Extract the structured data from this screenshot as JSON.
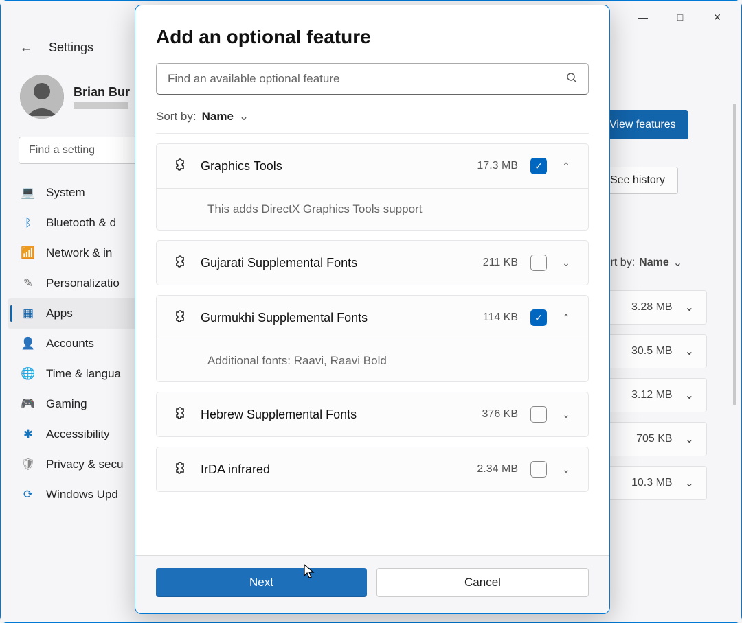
{
  "window": {
    "titlebar": {
      "minimize": "—",
      "maximize": "□",
      "close": "✕"
    },
    "back_label": "←",
    "app_title": "Settings",
    "user_name": "Brian Bur",
    "find_setting_placeholder": "Find a setting",
    "sidebar": [
      {
        "icon": "💻",
        "label": "System",
        "color": "#0078d4"
      },
      {
        "icon": "ᛒ",
        "label": "Bluetooth & d",
        "color": "#0078d4"
      },
      {
        "icon": "📶",
        "label": "Network & in",
        "color": "#0078d4"
      },
      {
        "icon": "✎",
        "label": "Personalizatio",
        "color": "#666"
      },
      {
        "icon": "▦",
        "label": "Apps",
        "color": "#0067c0",
        "active": true
      },
      {
        "icon": "👤",
        "label": "Accounts",
        "color": "#0078d4"
      },
      {
        "icon": "🌐",
        "label": "Time & langua",
        "color": "#0078d4"
      },
      {
        "icon": "🎮",
        "label": "Gaming",
        "color": "#888"
      },
      {
        "icon": "✱",
        "label": "Accessibility",
        "color": "#0078d4"
      },
      {
        "icon": "🛡",
        "label": "Privacy & secu",
        "color": "#888"
      },
      {
        "icon": "⟳",
        "label": "Windows Upd",
        "color": "#0078d4"
      }
    ],
    "right": {
      "view_features": "View features",
      "see_history": "See history",
      "sort_label": "Sort by:",
      "sort_value": "Name",
      "rows": [
        {
          "size": "3.28 MB"
        },
        {
          "size": "30.5 MB"
        },
        {
          "size": "3.12 MB"
        },
        {
          "size": "705 KB"
        },
        {
          "size": "10.3 MB"
        }
      ]
    }
  },
  "modal": {
    "title": "Add an optional feature",
    "search_placeholder": "Find an available optional feature",
    "sort_label": "Sort by:",
    "sort_value": "Name",
    "features": [
      {
        "name": "Graphics Tools",
        "size": "17.3 MB",
        "checked": true,
        "expanded": true,
        "description": "This adds DirectX Graphics Tools support"
      },
      {
        "name": "Gujarati Supplemental Fonts",
        "size": "211 KB",
        "checked": false,
        "expanded": false
      },
      {
        "name": "Gurmukhi Supplemental Fonts",
        "size": "114 KB",
        "checked": true,
        "expanded": true,
        "description": "Additional fonts: Raavi, Raavi Bold"
      },
      {
        "name": "Hebrew Supplemental Fonts",
        "size": "376 KB",
        "checked": false,
        "expanded": false
      },
      {
        "name": "IrDA infrared",
        "size": "2.34 MB",
        "checked": false,
        "expanded": false
      }
    ],
    "next_label": "Next",
    "cancel_label": "Cancel"
  }
}
